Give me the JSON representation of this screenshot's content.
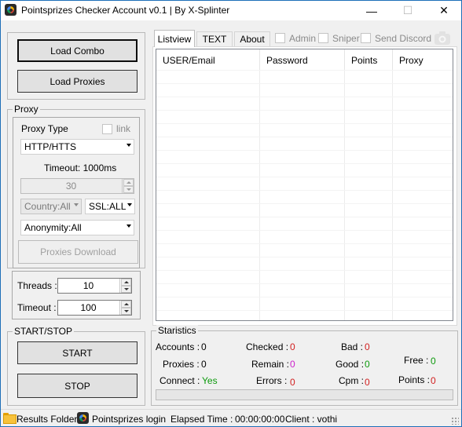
{
  "window": {
    "title": "Pointsprizes Checker Account v0.1 | By X-Splinter",
    "minimize_glyph": "—",
    "maximize_glyph": "☐",
    "close_glyph": "✕"
  },
  "left": {
    "load_combo": "Load Combo",
    "load_proxies": "Load Proxies",
    "proxy_group": "Proxy",
    "proxy_type_label": "Proxy Type",
    "link_label": "link",
    "proxy_type_value": "HTTP/HTTS",
    "timeout_label": "Timeout: 1000ms",
    "timeout_spin_value": "30",
    "country_value": "Country:All",
    "ssl_value": "SSL:ALL",
    "anonymity_value": "Anonymity:All",
    "proxies_download": "Proxies Download",
    "threads_label": "Threads :",
    "threads_value": "10",
    "timeout2_label": "Timeout :",
    "timeout2_value": "100",
    "start_stop_group": "START/STOP",
    "start_button": "START",
    "stop_button": "STOP"
  },
  "tabs": {
    "items": [
      "Listview",
      "TEXT",
      "About"
    ],
    "active": "Listview",
    "admin": "Admin",
    "sniper": "Sniper",
    "send_discord": "Send Discord"
  },
  "listview": {
    "columns": [
      "USER/Email",
      "Password",
      "Points",
      "Proxy"
    ]
  },
  "stats": {
    "group": "Staristics",
    "accounts_label": "Accounts :",
    "accounts_value": "0",
    "proxies_label": "Proxies :",
    "proxies_value": "0",
    "connect_label": "Connect :",
    "connect_value": "Yes",
    "checked_label": "Checked :",
    "checked_value": "0",
    "remain_label": "Remain :",
    "remain_value": "0",
    "errors_label": "Errors :",
    "errors_value": "0",
    "bad_label": "Bad :",
    "bad_value": "0",
    "good_label": "Good :",
    "good_value": "0",
    "cpm_label": "Cpm :",
    "cpm_value": "0",
    "free_label": "Free :",
    "free_value": "0",
    "points_label": "Points :",
    "points_value": "0",
    "progress_fraction": 0
  },
  "statusbar": {
    "results_folder": "Results Folder",
    "login": "Pointsprizes login",
    "elapsed": "Elapsed Time :",
    "elapsed_value": "00:00:00:00",
    "client": "Client : vothi"
  },
  "colors": {
    "green": "#0c9a0c",
    "red": "#d22020",
    "magenta": "#cc22cc",
    "accent_border": "#1e6fb8"
  }
}
